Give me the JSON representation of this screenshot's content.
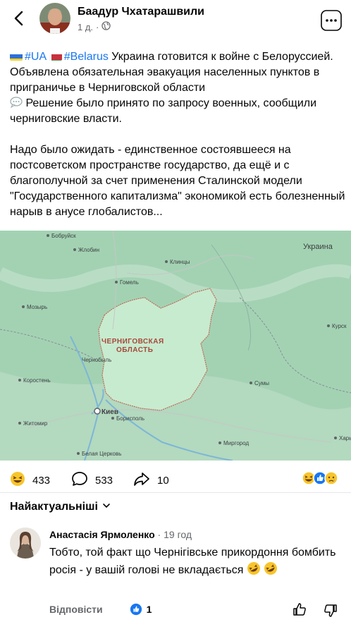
{
  "header": {
    "author": "Баадур Чхатарашвили",
    "time": "1 д.",
    "dot": "·"
  },
  "post": {
    "tag_ua": "#UA",
    "tag_by": "#Belarus",
    "line1_rest": " Украина готовится к войне с Белоруссией. Объявлена обязательная эвакуация населенных пунктов в приграничье в Черниговской области",
    "line2": " Решение было принято по запросу военных, сообщили черниговские власти.",
    "paragraph2": "Надо было ожидать - единственное состоявшееся на постсоветском пространстве государство, да ещё и с благополучной за счет применения Сталинской модели \"Государственного капитализма\" экономикой есть болезненный нарыв в анусе глобалистов..."
  },
  "map": {
    "region_label_1": "ЧЕРНИГОВСКАЯ",
    "region_label_2": "ОБЛАСТЬ",
    "cities": {
      "bobruysk": "Бобруйск",
      "ukraina": "Украина",
      "zhlobin": "Жлобин",
      "klintsy": "Клинцы",
      "gomel": "Гомель",
      "mozyr": "Мозырь",
      "kursk": "Курск",
      "chernobyl": "Чернобыль",
      "korosten": "Коростень",
      "sumy": "Сумы",
      "kiev": "Киев",
      "borispol": "Борисполь",
      "zhitomir": "Житомир",
      "mirgorod": "Миргород",
      "belaya_tserkov": "Белая Церковь",
      "kharkov": "Харь"
    }
  },
  "stats": {
    "reactions_count": "433",
    "comments_count": "533",
    "shares_count": "10"
  },
  "sort": {
    "label": "Найактуальніші"
  },
  "comment": {
    "author": "Анастасія Ярмоленко",
    "time": "19 год",
    "text": "Тобто, той факт що Чернігівське прикордоння бомбить росія - у вашій голові не вкладається",
    "reply_label": "Відповісти",
    "likes": "1"
  },
  "colors": {
    "link": "#1877f2",
    "map_land": "#a8d5b8",
    "region_fill": "#c9ecd0",
    "region_border": "#c06b5a"
  }
}
